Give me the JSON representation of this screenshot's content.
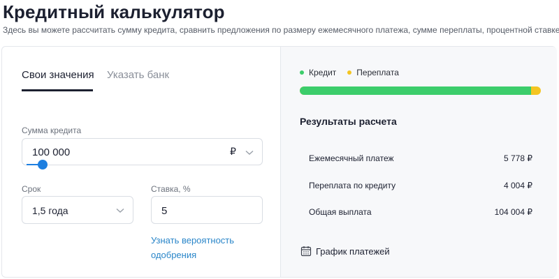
{
  "page": {
    "title": "Кредитный калькулятор",
    "subtitle": "Здесь вы можете рассчитать сумму кредита, сравнить предложения по размеру ежемесячного платежа, сумме переплаты, процентной ставке."
  },
  "tabs": [
    {
      "label": "Свои значения",
      "active": true
    },
    {
      "label": "Указать банк",
      "active": false
    }
  ],
  "form": {
    "amount": {
      "label": "Сумма кредита",
      "value": "100 000",
      "currency": "₽",
      "slider_fraction": 0.05
    },
    "term": {
      "label": "Срок",
      "value": "1,5 года"
    },
    "rate": {
      "label": "Ставка, %",
      "value": "5"
    },
    "approval_link": "Узнать вероятность одобрения"
  },
  "results": {
    "legend": [
      {
        "label": "Кредит",
        "color": "#3ccd6b"
      },
      {
        "label": "Переплата",
        "color": "#f4c521"
      }
    ],
    "credit_share": 0.96,
    "title": "Результаты расчета",
    "rows": [
      {
        "label": "Ежемесячный платеж",
        "value": "5 778 ₽"
      },
      {
        "label": "Переплата по кредиту",
        "value": "4 004 ₽"
      },
      {
        "label": "Общая выплата",
        "value": "104 004 ₽"
      }
    ],
    "schedule_link": "График платежей"
  },
  "icons": {
    "chevron": "chevron-down-icon",
    "calendar": "calendar-icon"
  },
  "colors": {
    "accent": "#1e7fe0",
    "link": "#2a86c9",
    "credit": "#3ccd6b",
    "overpayment": "#f4c521"
  }
}
